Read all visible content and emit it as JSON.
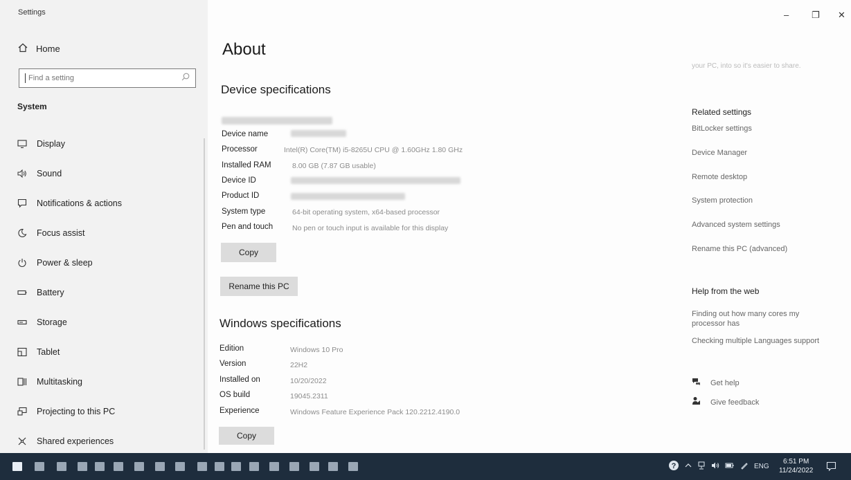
{
  "app": {
    "title": "Settings"
  },
  "window_controls": {
    "minimize": "–",
    "maximize": "❐",
    "close": "✕"
  },
  "sidebar": {
    "home": {
      "label": "Home",
      "icon": "home-icon"
    },
    "search": {
      "placeholder": "Find a setting",
      "icon": "search-icon"
    },
    "section": "System",
    "items": [
      {
        "label": "Display",
        "icon": "display-icon"
      },
      {
        "label": "Sound",
        "icon": "sound-icon"
      },
      {
        "label": "Notifications & actions",
        "icon": "notifications-icon"
      },
      {
        "label": "Focus assist",
        "icon": "moon-icon"
      },
      {
        "label": "Power & sleep",
        "icon": "power-icon"
      },
      {
        "label": "Battery",
        "icon": "battery-icon"
      },
      {
        "label": "Storage",
        "icon": "storage-icon"
      },
      {
        "label": "Tablet",
        "icon": "tablet-icon"
      },
      {
        "label": "Multitasking",
        "icon": "multitasking-icon"
      },
      {
        "label": "Projecting to this PC",
        "icon": "projecting-icon"
      },
      {
        "label": "Shared experiences",
        "icon": "shared-experiences-icon"
      }
    ]
  },
  "main": {
    "title": "About",
    "device_specs": {
      "heading": "Device specifications",
      "rows": [
        {
          "label": "Device name",
          "value": ""
        },
        {
          "label": "Processor",
          "value": "Intel(R) Core(TM) i5-8265U CPU @ 1.60GHz   1.80 GHz"
        },
        {
          "label": "Installed RAM",
          "value": "8.00 GB (7.87 GB usable)"
        },
        {
          "label": "Device ID",
          "value": ""
        },
        {
          "label": "Product ID",
          "value": ""
        },
        {
          "label": "System type",
          "value": "64-bit operating system, x64-based processor"
        },
        {
          "label": "Pen and touch",
          "value": "No pen or touch input is available for this display"
        }
      ],
      "copy_label": "Copy",
      "rename_label": "Rename this PC"
    },
    "windows_specs": {
      "heading": "Windows specifications",
      "rows": [
        {
          "label": "Edition",
          "value": "Windows 10 Pro"
        },
        {
          "label": "Version",
          "value": "22H2"
        },
        {
          "label": "Installed on",
          "value": "10/20/2022"
        },
        {
          "label": "OS build",
          "value": "19045.2311"
        },
        {
          "label": "Experience",
          "value": "Windows Feature Experience Pack 120.2212.4190.0"
        }
      ],
      "copy_label": "Copy"
    }
  },
  "right_panel": {
    "top_fragment": "your PC, into so it's easier to share.",
    "related_heading": "Related settings",
    "related_links": [
      "BitLocker settings",
      "Device Manager",
      "Remote desktop",
      "System protection",
      "Advanced system settings",
      "Rename this PC (advanced)"
    ],
    "help_heading": "Help from the web",
    "help_links": [
      "Finding out how many cores my processor has",
      "Checking multiple Languages support"
    ],
    "get_help": "Get help",
    "give_feedback": "Give feedback"
  },
  "taskbar": {
    "tray": {
      "language": "ENG",
      "time": "6:51 PM",
      "date": "11/24/2022"
    }
  }
}
